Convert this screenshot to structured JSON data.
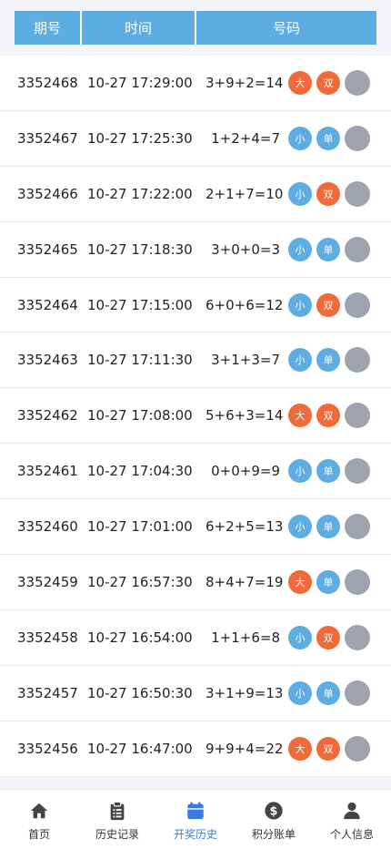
{
  "header": {
    "col_issue": "期号",
    "col_time": "时间",
    "col_numbers": "号码"
  },
  "rows": [
    {
      "issue": "3352468",
      "time": "10-27 17:29:00",
      "sum": "3+9+2=14",
      "size": "大",
      "size_color": "orange",
      "parity": "双",
      "parity_color": "orange"
    },
    {
      "issue": "3352467",
      "time": "10-27 17:25:30",
      "sum": "1+2+4=7",
      "size": "小",
      "size_color": "blue",
      "parity": "单",
      "parity_color": "blue"
    },
    {
      "issue": "3352466",
      "time": "10-27 17:22:00",
      "sum": "2+1+7=10",
      "size": "小",
      "size_color": "blue",
      "parity": "双",
      "parity_color": "orange"
    },
    {
      "issue": "3352465",
      "time": "10-27 17:18:30",
      "sum": "3+0+0=3",
      "size": "小",
      "size_color": "blue",
      "parity": "单",
      "parity_color": "blue"
    },
    {
      "issue": "3352464",
      "time": "10-27 17:15:00",
      "sum": "6+0+6=12",
      "size": "小",
      "size_color": "blue",
      "parity": "双",
      "parity_color": "orange"
    },
    {
      "issue": "3352463",
      "time": "10-27 17:11:30",
      "sum": "3+1+3=7",
      "size": "小",
      "size_color": "blue",
      "parity": "单",
      "parity_color": "blue"
    },
    {
      "issue": "3352462",
      "time": "10-27 17:08:00",
      "sum": "5+6+3=14",
      "size": "大",
      "size_color": "orange",
      "parity": "双",
      "parity_color": "orange"
    },
    {
      "issue": "3352461",
      "time": "10-27 17:04:30",
      "sum": "0+0+9=9",
      "size": "小",
      "size_color": "blue",
      "parity": "单",
      "parity_color": "blue"
    },
    {
      "issue": "3352460",
      "time": "10-27 17:01:00",
      "sum": "6+2+5=13",
      "size": "小",
      "size_color": "blue",
      "parity": "单",
      "parity_color": "blue"
    },
    {
      "issue": "3352459",
      "time": "10-27 16:57:30",
      "sum": "8+4+7=19",
      "size": "大",
      "size_color": "orange",
      "parity": "单",
      "parity_color": "blue"
    },
    {
      "issue": "3352458",
      "time": "10-27 16:54:00",
      "sum": "1+1+6=8",
      "size": "小",
      "size_color": "blue",
      "parity": "双",
      "parity_color": "orange"
    },
    {
      "issue": "3352457",
      "time": "10-27 16:50:30",
      "sum": "3+1+9=13",
      "size": "小",
      "size_color": "blue",
      "parity": "单",
      "parity_color": "blue"
    },
    {
      "issue": "3352456",
      "time": "10-27 16:47:00",
      "sum": "9+9+4=22",
      "size": "大",
      "size_color": "orange",
      "parity": "双",
      "parity_color": "orange"
    }
  ],
  "tabbar": {
    "items": [
      {
        "label": "首页",
        "icon": "home-icon",
        "active": false
      },
      {
        "label": "历史记录",
        "icon": "clipboard-icon",
        "active": false
      },
      {
        "label": "开奖历史",
        "icon": "calendar-icon",
        "active": true
      },
      {
        "label": "积分账单",
        "icon": "dollar-coin-icon",
        "active": false
      },
      {
        "label": "个人信息",
        "icon": "user-icon",
        "active": false
      }
    ]
  },
  "colors": {
    "header_bg": "#5dade2",
    "orange": "#f06a3a",
    "blue": "#5dade2",
    "gray": "#9ea3ad",
    "active_tab": "#3a7be0"
  }
}
